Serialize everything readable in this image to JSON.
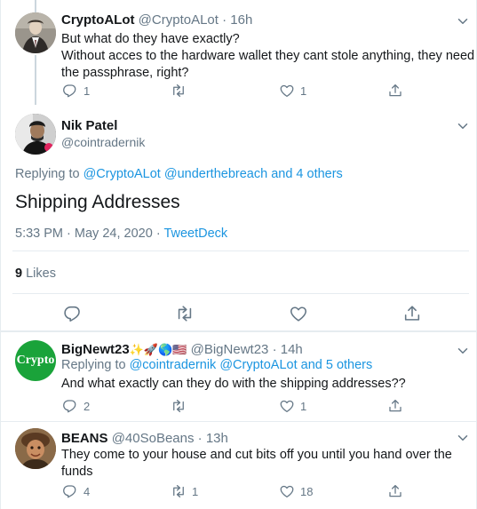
{
  "reply1": {
    "name": "CryptoALot",
    "handle": "@CryptoALot",
    "sep": "·",
    "time": "16h",
    "line1": "But what do they have exactly?",
    "line2": "Without acces to the hardware wallet they cant stole anything, they need",
    "line3": "the passphrase, right?",
    "reply_count": "1",
    "like_count": "1"
  },
  "main": {
    "name": "Nik Patel",
    "handle": "@cointradernik",
    "replying_prefix": "Replying to",
    "replying_links": "@CryptoALot @underthebreach and 4 others",
    "body": "Shipping Addresses",
    "time": "5:33 PM",
    "date": "May 24, 2020",
    "source": "TweetDeck",
    "dot": "·",
    "likes_count": "9",
    "likes_label": "Likes"
  },
  "reply2": {
    "avatar_text": "Crypto",
    "name": "BigNewt23",
    "emoji": "✨🚀🌎🇺🇸",
    "handle": "@BigNewt23",
    "sep": "·",
    "time": "14h",
    "replying_prefix": "Replying to",
    "replying_links": "@cointradernik @CryptoALot and 5 others",
    "body": "And what exactly can they do with the shipping addresses??",
    "reply_count": "2",
    "like_count": "1"
  },
  "reply3": {
    "name": "BEANS",
    "handle": "@40SoBeans",
    "sep": "·",
    "time": "13h",
    "line1": "They come to your house and cut bits off you until you hand over the",
    "line2": "funds",
    "reply_count": "4",
    "retweet_count": "1",
    "like_count": "18"
  },
  "colors": {
    "accent": "#1b95e0",
    "muted": "#657786",
    "crypto_green": "#1aa33a"
  }
}
